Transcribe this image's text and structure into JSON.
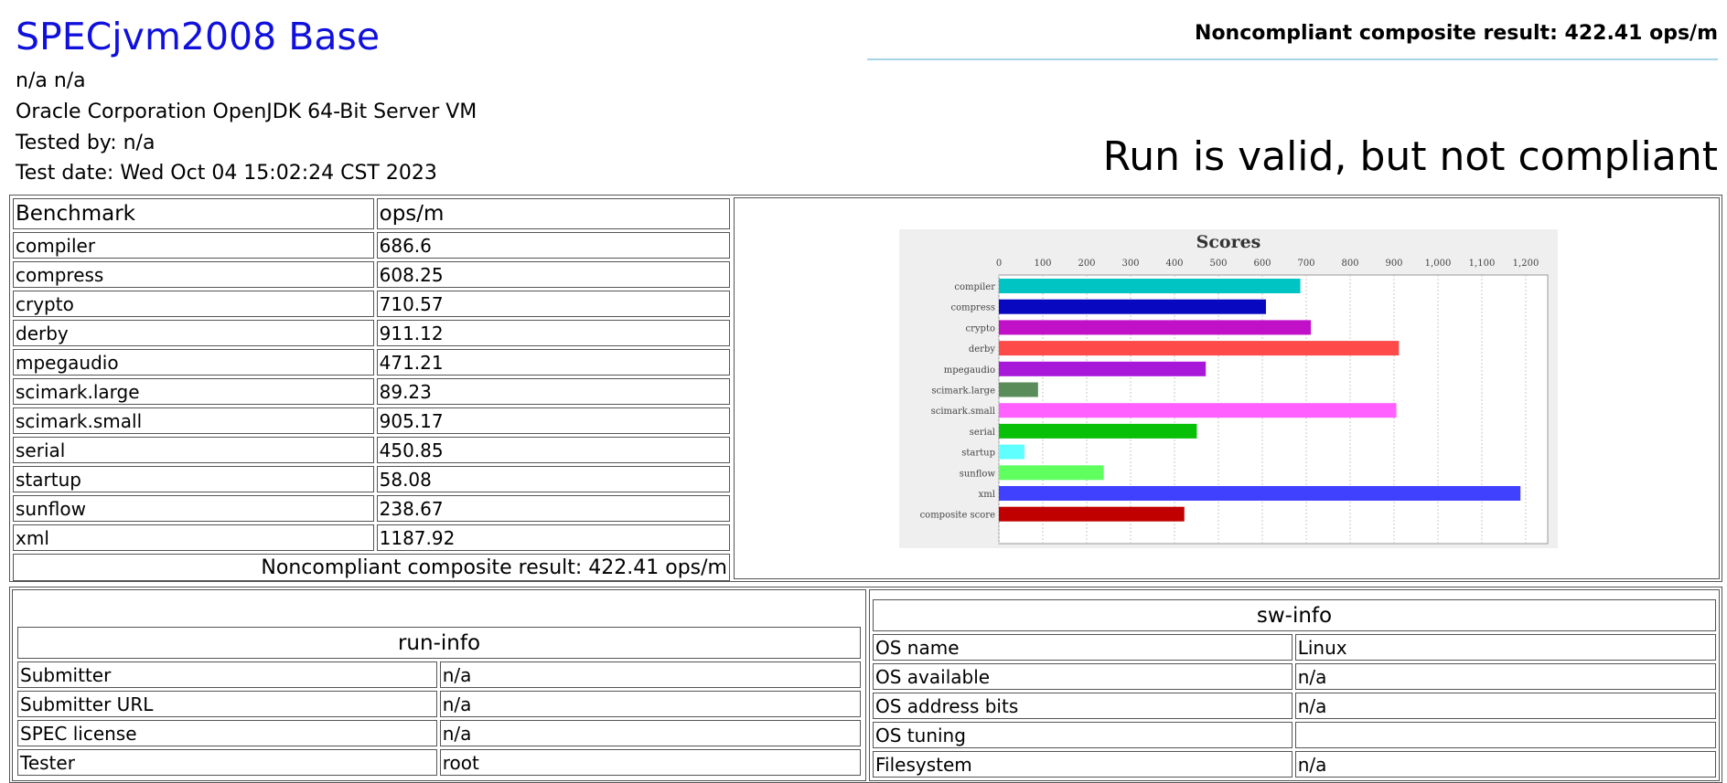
{
  "header": {
    "title": "SPECjvm2008 Base",
    "line1": "n/a n/a",
    "line2": "Oracle Corporation OpenJDK 64-Bit Server VM",
    "line3": "Tested by: n/a",
    "line4": "Test date: Wed Oct 04 15:02:24 CST 2023",
    "composite_top": "Noncompliant composite result: 422.41 ops/m",
    "status": "Run is valid, but not compliant"
  },
  "results": {
    "col_benchmark": "Benchmark",
    "col_ops": "ops/m",
    "rows": [
      {
        "name": "compiler",
        "value": "686.6"
      },
      {
        "name": "compress",
        "value": "608.25"
      },
      {
        "name": "crypto",
        "value": "710.57"
      },
      {
        "name": "derby",
        "value": "911.12"
      },
      {
        "name": "mpegaudio",
        "value": "471.21"
      },
      {
        "name": "scimark.large",
        "value": "89.23"
      },
      {
        "name": "scimark.small",
        "value": "905.17"
      },
      {
        "name": "serial",
        "value": "450.85"
      },
      {
        "name": "startup",
        "value": "58.08"
      },
      {
        "name": "sunflow",
        "value": "238.67"
      },
      {
        "name": "xml",
        "value": "1187.92"
      }
    ],
    "composite": "Noncompliant composite result: 422.41 ops/m"
  },
  "chart_data": {
    "type": "bar",
    "orientation": "horizontal",
    "title": "Scores",
    "categories": [
      "compiler",
      "compress",
      "crypto",
      "derby",
      "mpegaudio",
      "scimark.large",
      "scimark.small",
      "serial",
      "startup",
      "sunflow",
      "xml",
      "composite score"
    ],
    "values": [
      686.6,
      608.25,
      710.57,
      911.12,
      471.21,
      89.23,
      905.17,
      450.85,
      58.08,
      238.67,
      1187.92,
      422.41
    ],
    "colors": [
      "#00c4c4",
      "#0808c0",
      "#c010c8",
      "#ff4a4a",
      "#a818d8",
      "#5a8c5a",
      "#ff60ff",
      "#08c008",
      "#60ffff",
      "#60ff60",
      "#4040ff",
      "#c00000"
    ],
    "xticks": [
      "0",
      "100",
      "200",
      "300",
      "400",
      "500",
      "600",
      "700",
      "800",
      "900",
      "1,000",
      "1,100",
      "1,200"
    ],
    "xlim": [
      0,
      1250
    ],
    "grid": true
  },
  "run_info": {
    "heading": "run-info",
    "rows": [
      {
        "key": "Submitter",
        "value": "n/a"
      },
      {
        "key": "Submitter URL",
        "value": "n/a"
      },
      {
        "key": "SPEC license",
        "value": "n/a"
      },
      {
        "key": "Tester",
        "value": "root"
      }
    ]
  },
  "sw_info": {
    "heading": "sw-info",
    "rows": [
      {
        "key": "OS name",
        "value": "Linux"
      },
      {
        "key": "OS available",
        "value": "n/a"
      },
      {
        "key": "OS address bits",
        "value": "n/a"
      },
      {
        "key": "OS tuning",
        "value": ""
      },
      {
        "key": "Filesystem",
        "value": "n/a"
      }
    ]
  }
}
